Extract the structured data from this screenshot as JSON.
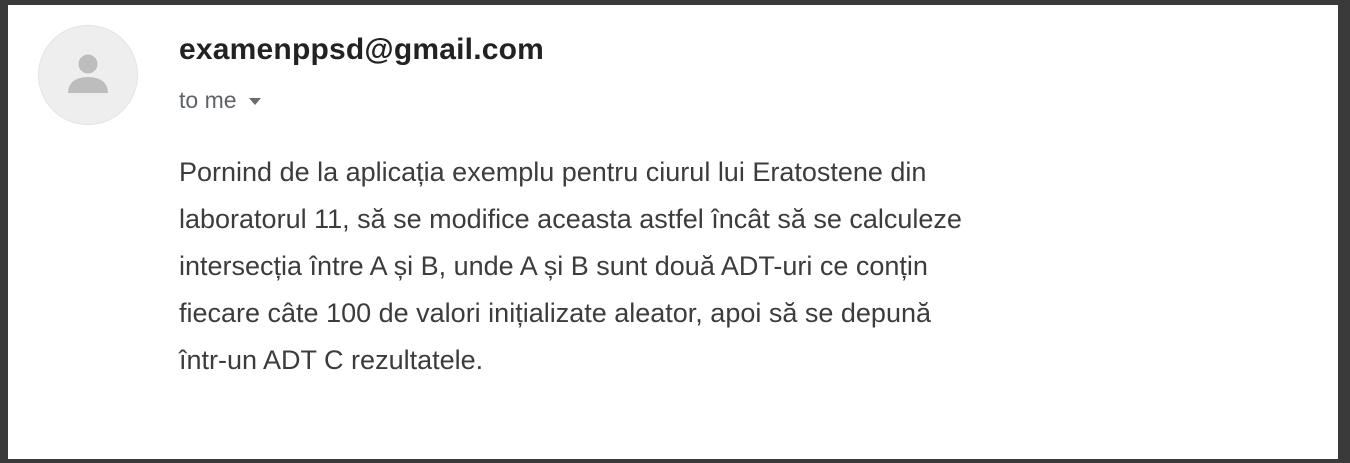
{
  "email": {
    "sender": "examenppsd@gmail.com",
    "recipient_label": "to me",
    "body_lines": [
      "Pornind de la aplicația exemplu pentru ciurul lui Eratostene din",
      "laboratorul 11, să se modifice aceasta astfel încât să se calculeze",
      "intersecția între A și B, unde A și B sunt două ADT-uri ce conțin",
      "fiecare câte 100 de valori inițializate aleator, apoi să se depună",
      "într-un ADT C rezultatele."
    ]
  },
  "icons": {
    "avatar": "person-icon",
    "recipient_dropdown": "caret-down-icon"
  },
  "colors": {
    "sender": "#222222",
    "meta": "#5f6368",
    "body": "#3c3c3c",
    "avatar_bg": "#eeeeee",
    "avatar_glyph": "#bdbdbd",
    "frame": "#3a3a3a"
  }
}
